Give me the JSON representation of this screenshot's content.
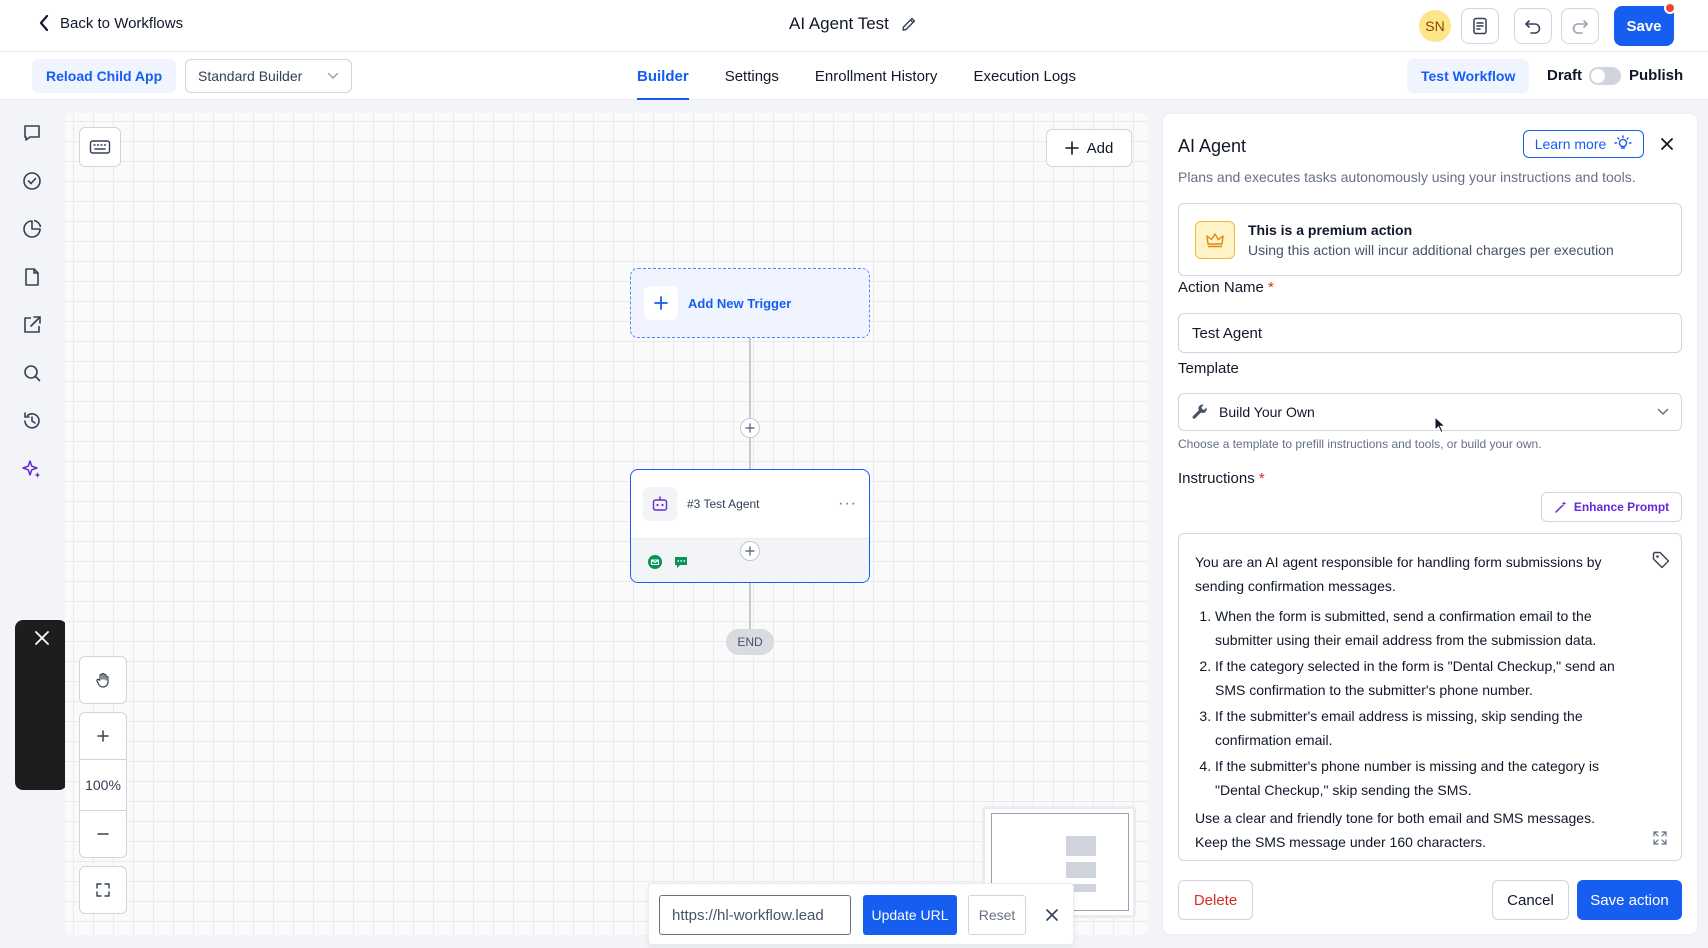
{
  "header": {
    "back_label": "Back to Workflows",
    "title": "AI Agent Test",
    "avatar_initials": "SN",
    "save_label": "Save"
  },
  "subbar": {
    "reload_label": "Reload Child App",
    "builder_mode": "Standard Builder",
    "tabs": [
      {
        "label": "Builder",
        "active": true
      },
      {
        "label": "Settings",
        "active": false
      },
      {
        "label": "Enrollment History",
        "active": false
      },
      {
        "label": "Execution Logs",
        "active": false
      }
    ],
    "test_workflow_label": "Test Workflow",
    "draft_label": "Draft",
    "publish_label": "Publish",
    "published": false
  },
  "sidebar": {
    "icons": [
      "chat-icon",
      "check-circle-icon",
      "pie-chart-icon",
      "document-icon",
      "external-link-icon",
      "search-icon",
      "history-icon",
      "sparkle-icon"
    ]
  },
  "canvas": {
    "add_label": "Add",
    "trigger_label": "Add New Trigger",
    "node_label": "#3 Test Agent",
    "end_label": "END",
    "zoom_level": "100%",
    "url_value": "https://hl-workflow.lead",
    "update_url_label": "Update URL",
    "reset_label": "Reset"
  },
  "panel": {
    "title": "AI Agent",
    "learn_more_label": "Learn more",
    "description": "Plans and executes tasks autonomously using your instructions and tools.",
    "premium_title": "This is a premium action",
    "premium_desc": "Using this action will incur additional charges per execution",
    "action_name_label": "Action Name",
    "action_name_value": "Test Agent",
    "template_label": "Template",
    "template_value": "Build Your Own",
    "template_hint": "Choose a template to prefill instructions and tools, or build your own.",
    "instructions_label": "Instructions",
    "enhance_label": "Enhance Prompt",
    "instructions": {
      "intro": "You are an AI agent responsible for handling form submissions by sending confirmation messages.",
      "steps": [
        "When the form is submitted, send a confirmation email to the submitter using their email address from the submission data.",
        "If the category selected in the form is \"Dental Checkup,\" send an SMS confirmation to the submitter's phone number.",
        "If the submitter's email address is missing, skip sending the confirmation email.",
        "If the submitter's phone number is missing and the category is \"Dental Checkup,\" skip sending the SMS."
      ],
      "outro": "Use a clear and friendly tone for both email and SMS messages. Keep the SMS message under 160 characters."
    },
    "delete_label": "Delete",
    "cancel_label": "Cancel",
    "save_action_label": "Save action"
  },
  "colors": {
    "primary": "#155eef",
    "danger": "#d92d20",
    "accent_purple": "#6927da",
    "premium_gold": "#f5b82e"
  }
}
